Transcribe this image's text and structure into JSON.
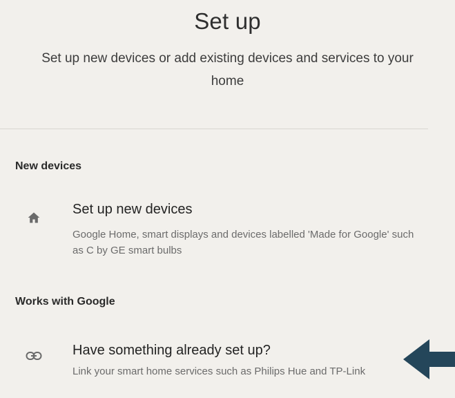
{
  "header": {
    "title": "Set up",
    "subtitle": "Set up new devices or add existing devices and services to your home"
  },
  "sections": [
    {
      "header": "New devices",
      "item": {
        "icon": "home-icon",
        "title": "Set up new devices",
        "description": "Google Home, smart displays and devices labelled 'Made for Google' such as C by GE smart bulbs"
      }
    },
    {
      "header": "Works with Google",
      "item": {
        "icon": "link-icon",
        "title": "Have something already set up?",
        "description": "Link your smart home services such as Philips Hue and TP-Link"
      }
    }
  ],
  "annotation": {
    "icon": "arrow-left-icon",
    "color": "#24465a"
  },
  "colors": {
    "background": "#f2f0ec",
    "text_primary": "#232323",
    "text_secondary": "#6b6b6b",
    "icon": "#6a6a6a"
  }
}
